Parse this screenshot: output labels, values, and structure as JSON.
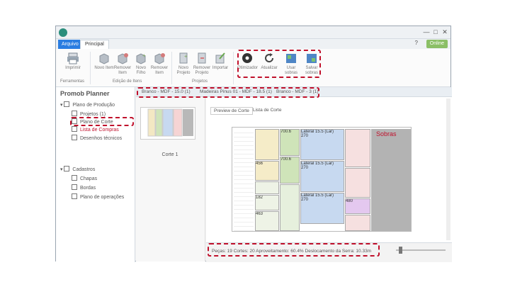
{
  "window": {
    "file_tab": "Arquivo",
    "main_tab": "Principal",
    "user_button": "Online",
    "help_glyph": "?",
    "minimize_glyph": "—",
    "maximize_glyph": "□",
    "close_glyph": "✕"
  },
  "ribbon": {
    "buttons": [
      {
        "label": "Imprimir",
        "icon": "printer-icon"
      },
      {
        "label": "Novo Item",
        "icon": "new-item-icon"
      },
      {
        "label": "Remover Item",
        "icon": "remove-item-icon"
      },
      {
        "label": "Novo Filho",
        "icon": "new-child-icon"
      },
      {
        "label": "Remover Item",
        "icon": "remove-item-icon"
      },
      {
        "label": "Novo Projeto",
        "icon": "new-project-icon"
      },
      {
        "label": "Remover Projeto",
        "icon": "remove-project-icon"
      },
      {
        "label": "Importar",
        "icon": "import-icon"
      },
      {
        "label": "Otimizador",
        "icon": "gear-icon"
      },
      {
        "label": "Atualizar",
        "icon": "refresh-icon"
      },
      {
        "label": "Usar sobras",
        "icon": "use-leftovers-icon"
      },
      {
        "label": "Salvar sobras",
        "icon": "save-leftovers-icon"
      }
    ],
    "groups": [
      "Ferramentas",
      "Edição de Itens",
      "Projetos"
    ]
  },
  "left_panel": {
    "title": "Promob Planner",
    "tree": [
      {
        "label": "Plano de Produção",
        "level": 0
      },
      {
        "label": "Projetos (1)",
        "level": 1
      },
      {
        "label": "Plano de Corte",
        "level": 1
      },
      {
        "label": "Lista de Compras",
        "level": 1
      },
      {
        "label": "Desenhos técnicos",
        "level": 1
      },
      {
        "label": "Cadastros",
        "level": 0
      },
      {
        "label": "Chapas",
        "level": 1
      },
      {
        "label": "Bordas",
        "level": 1
      },
      {
        "label": "Plano de operações",
        "level": 1
      }
    ]
  },
  "sheets": [
    "Branco - MDF - 15.0 (1)",
    "Madeiras Pinus 01 - MDF - 18.5 (1)",
    "Branco - MDF - 3 (1)"
  ],
  "thumbnail_caption": "Corte 1",
  "view_tabs": [
    "Preview de Corte",
    "Lista de Corte"
  ],
  "plan": {
    "leftovers_label": "Sobras",
    "parts": [
      {
        "label": "Lateral 15.5 (Lar)"
      },
      {
        "label": "Lateral 15.5 (Lar)"
      },
      {
        "label": "Lateral 15.5 (Lar)"
      },
      {
        "label": "700.6"
      },
      {
        "label": "700.6"
      },
      {
        "label": "270"
      },
      {
        "label": "270"
      },
      {
        "label": "270"
      },
      {
        "label": "182"
      },
      {
        "label": "463"
      },
      {
        "label": "456"
      },
      {
        "label": "480"
      }
    ]
  },
  "status": {
    "text": "Peças: 19    Cortes: 20    Aproveitamento: 60.4%    Deslocamento da Serra: 10.33m"
  },
  "colors": {
    "highlight": "#c0102b",
    "accent": "#2a7de1",
    "user": "#8bbf66"
  }
}
